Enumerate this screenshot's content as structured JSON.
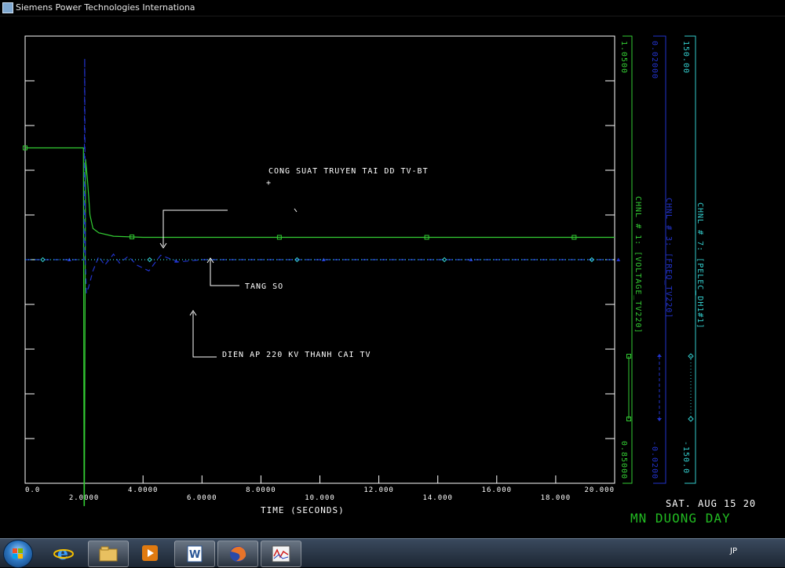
{
  "window": {
    "title": "Siemens Power Technologies Internationa"
  },
  "chart_data": {
    "type": "line",
    "x_ticks": [
      "0.0",
      "2.0000",
      "4.0000",
      "6.0000",
      "8.0000",
      "10.000",
      "12.000",
      "14.000",
      "16.000",
      "18.000",
      "20.000"
    ],
    "xlabel": "TIME (SECONDS)",
    "xlim": [
      0,
      20
    ],
    "annotations": [
      "CONG SUAT TRUYEN TAI DD TV-BT",
      "TANG SO",
      "DIEN AP 220 KV THANH CAI TV"
    ],
    "channels": [
      {
        "label": "CHNL # 1: [VOLTAGE_TV220]",
        "max_label": "1.0500",
        "min_label": "0.85000",
        "color": "#33cc33"
      },
      {
        "label": "CHNL # 3: [FREQ_TV220]",
        "max_label": "0.02000",
        "min_label": "-0.0200",
        "color": "#2233cc"
      },
      {
        "label": "CHNL # 7: [PELEC_DH1#1]",
        "max_label": "150.00",
        "min_label": "-150.0",
        "color": "#33cccc"
      }
    ],
    "series": [
      {
        "name": "CHNL # 1: [VOLTAGE_TV220]",
        "ylim": [
          0.85,
          1.05
        ],
        "x": [
          0,
          1.98,
          2.0,
          2.01,
          2.05,
          2.12,
          2.2,
          2.3,
          2.5,
          3.0,
          4.0,
          6.0,
          10.0,
          14.0,
          18.0,
          20.0
        ],
        "values": [
          1.0,
          1.0,
          0.84,
          0.84,
          0.995,
          0.985,
          0.97,
          0.964,
          0.962,
          0.9605,
          0.96,
          0.96,
          0.96,
          0.96,
          0.96,
          0.96
        ]
      },
      {
        "name": "CHNL # 3: [FREQ_TV220]",
        "ylim": [
          -0.02,
          0.02
        ],
        "x": [
          0,
          2.0,
          2.02,
          2.04,
          2.08,
          2.15,
          2.3,
          2.5,
          2.7,
          3.0,
          3.2,
          3.5,
          3.8,
          4.2,
          4.6,
          5.2,
          6.0,
          8.0,
          10.0,
          14.0,
          18.0,
          20.0
        ],
        "values": [
          0.0,
          0.0,
          0.018,
          0.0,
          -0.003,
          -0.0025,
          -0.001,
          0.0003,
          -0.0005,
          0.0005,
          -0.0003,
          0.0003,
          -0.0005,
          -0.001,
          0.0004,
          -0.0002,
          0.0,
          0.0,
          0.0,
          0.0,
          0.0,
          0.0
        ]
      },
      {
        "name": "CHNL # 7: [PELEC_DH1#1]",
        "ylim": [
          -150,
          150
        ],
        "x": [
          0,
          20
        ],
        "values": [
          0,
          0
        ]
      }
    ]
  },
  "footer": {
    "date": "SAT. AUG 15 20",
    "case_title": "MN DUONG DAY"
  },
  "taskbar": {
    "apps": [
      {
        "name": "internet-explorer",
        "open": false
      },
      {
        "name": "file-explorer",
        "open": true
      },
      {
        "name": "media-player",
        "open": false
      },
      {
        "name": "word",
        "open": true
      },
      {
        "name": "firefox",
        "open": true
      },
      {
        "name": "pss-plot",
        "open": true
      }
    ],
    "tray_lang": "JP"
  },
  "colors": {
    "voltage": "#33cc33",
    "freq": "#2233cc",
    "pelec": "#33cccc",
    "axis": "#ffffff",
    "background": "#000000"
  }
}
